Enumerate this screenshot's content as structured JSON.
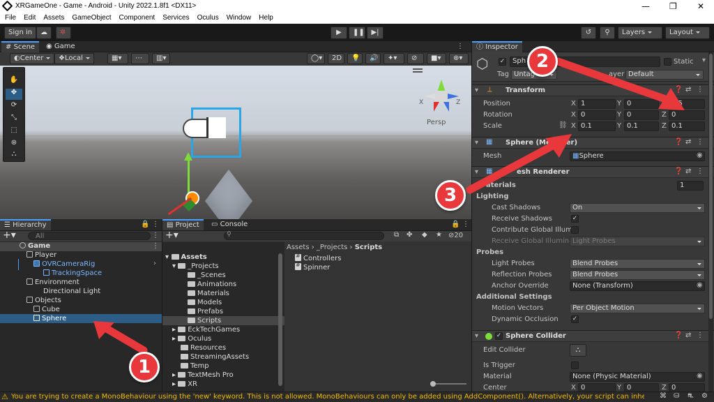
{
  "window": {
    "title": "XRGameOne - Game - Android - Unity 2022.1.8f1 <DX11>",
    "minimize": "—",
    "maximize": "❐",
    "close": "✕"
  },
  "menu": [
    "File",
    "Edit",
    "Assets",
    "GameObject",
    "Component",
    "Services",
    "Oculus",
    "Window",
    "Help"
  ],
  "toolbar": {
    "sign_in": "Sign in",
    "layers": "Layers",
    "layout": "Layout"
  },
  "scene": {
    "tab_scene": "Scene",
    "tab_game": "Game",
    "pivot": "Center",
    "space": "Local",
    "mode_2d": "2D",
    "persp": "Persp",
    "axis_x": "X",
    "axis_z": "Z",
    "axis_y": "Y"
  },
  "hierarchy": {
    "title": "Hierarchy",
    "search_placeholder": "All",
    "items": [
      {
        "label": "Game"
      },
      {
        "label": "Player"
      },
      {
        "label": "OVRCameraRig"
      },
      {
        "label": "TrackingSpace"
      },
      {
        "label": "Environment"
      },
      {
        "label": "Directional Light"
      },
      {
        "label": "Objects"
      },
      {
        "label": "Cube"
      },
      {
        "label": "Sphere"
      }
    ]
  },
  "project": {
    "tab_project": "Project",
    "tab_console": "Console",
    "hidden_count": "20",
    "tree": [
      {
        "label": "Assets"
      },
      {
        "label": "_Projects"
      },
      {
        "label": "_Scenes"
      },
      {
        "label": "Animations"
      },
      {
        "label": "Materials"
      },
      {
        "label": "Models"
      },
      {
        "label": "Prefabs"
      },
      {
        "label": "Scripts"
      },
      {
        "label": "EckTechGames"
      },
      {
        "label": "Oculus"
      },
      {
        "label": "Resources"
      },
      {
        "label": "StreamingAssets"
      },
      {
        "label": "Temp"
      },
      {
        "label": "TextMesh Pro"
      },
      {
        "label": "XR"
      }
    ],
    "breadcrumb": [
      "Assets",
      "_Projects",
      "Scripts"
    ],
    "files": [
      "Controllers",
      "Spinner"
    ]
  },
  "inspector": {
    "title": "Inspector",
    "object_name": "Sph",
    "static_label": "Static",
    "tag_label": "Tag",
    "tag_value": "Untag",
    "layer_label": "ayer",
    "layer_value": "Default",
    "transform": {
      "title": "Transform",
      "position_label": "Position",
      "rotation_label": "Rotation",
      "scale_label": "Scale",
      "position": {
        "x": "1",
        "y": "0",
        "z": "0.5"
      },
      "rotation": {
        "x": "0",
        "y": "0",
        "z": "0"
      },
      "scale": {
        "x": "0.1",
        "y": "0.1",
        "z": "0.1"
      }
    },
    "mesh_filter": {
      "title": "Sphere (Me",
      "title_tail": "er)",
      "mesh_label": "Mesh",
      "mesh_value": "Sphere"
    },
    "mesh_renderer": {
      "title": "esh Renderer",
      "materials_label": "aterials",
      "materials_count": "1",
      "lighting": "Lighting",
      "cast_shadows_label": "Cast Shadows",
      "cast_shadows_value": "On",
      "receive_shadows_label": "Receive Shadows",
      "contribute_gi_label": "Contribute Global Illumi",
      "receive_gi_label": "Receive Global Illumina",
      "receive_gi_value": "Light Probes",
      "probes": "Probes",
      "light_probes_label": "Light Probes",
      "light_probes_value": "Blend Probes",
      "reflection_probes_label": "Reflection Probes",
      "reflection_probes_value": "Blend Probes",
      "anchor_override_label": "Anchor Override",
      "anchor_override_value": "None (Transform)",
      "additional": "Additional Settings",
      "motion_vectors_label": "Motion Vectors",
      "motion_vectors_value": "Per Object Motion",
      "dynamic_occlusion_label": "Dynamic Occlusion"
    },
    "sphere_collider": {
      "title": "Sphere Collider",
      "edit_collider_label": "Edit Collider",
      "is_trigger_label": "Is Trigger",
      "material_label": "Material",
      "material_value": "None (Physic Material)",
      "center_label": "Center",
      "center": {
        "x": "0",
        "y": "0",
        "z": "0"
      }
    }
  },
  "status": {
    "message": "You are trying to create a MonoBehaviour using the 'new' keyword.  This is not allowed.  MonoBehaviours can only be added using AddComponent(). Alternatively, your script can inherit from S"
  },
  "annotations": {
    "one": "1",
    "two": "2",
    "three": "3"
  },
  "colors": {
    "accent": "#4a9fff",
    "selection": "#2c5d87",
    "annotation": "#e8383c",
    "warning": "#f4bc02"
  }
}
